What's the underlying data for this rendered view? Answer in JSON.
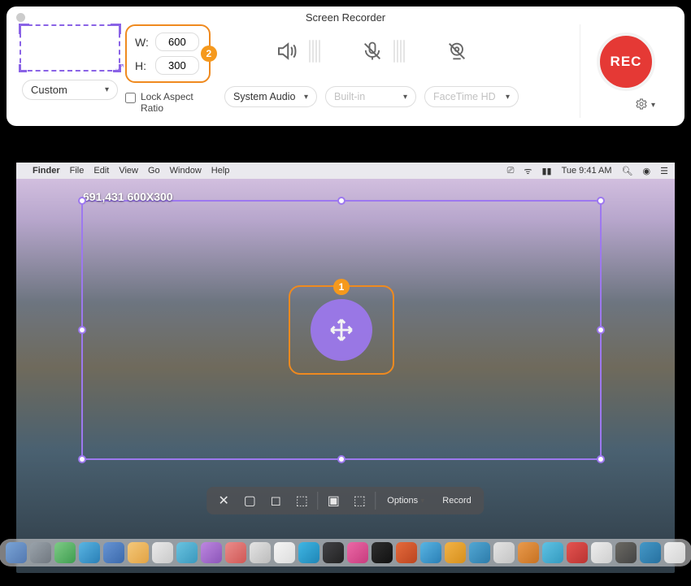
{
  "window": {
    "title": "Screen Recorder"
  },
  "region": {
    "preset": "Custom",
    "width_label": "W:",
    "height_label": "H:",
    "width": "600",
    "height": "300",
    "annotation_badge": "2",
    "lock_aspect_label": "Lock Aspect Ratio",
    "lock_aspect_checked": false
  },
  "audio": {
    "system_select": "System Audio",
    "mic_select": "Built-in",
    "camera_select": "FaceTime HD"
  },
  "controls": {
    "record_label": "REC",
    "settings_icon": "gear"
  },
  "desktop": {
    "menubar": {
      "app": "Finder",
      "menus": [
        "File",
        "Edit",
        "View",
        "Go",
        "Window",
        "Help"
      ],
      "clock": "Tue 9:41 AM"
    },
    "selection_label": "691,431 600X300",
    "move_annotation_badge": "1",
    "screenshot_bar": {
      "options_label": "Options",
      "record_label": "Record"
    },
    "dock_count": 28
  }
}
